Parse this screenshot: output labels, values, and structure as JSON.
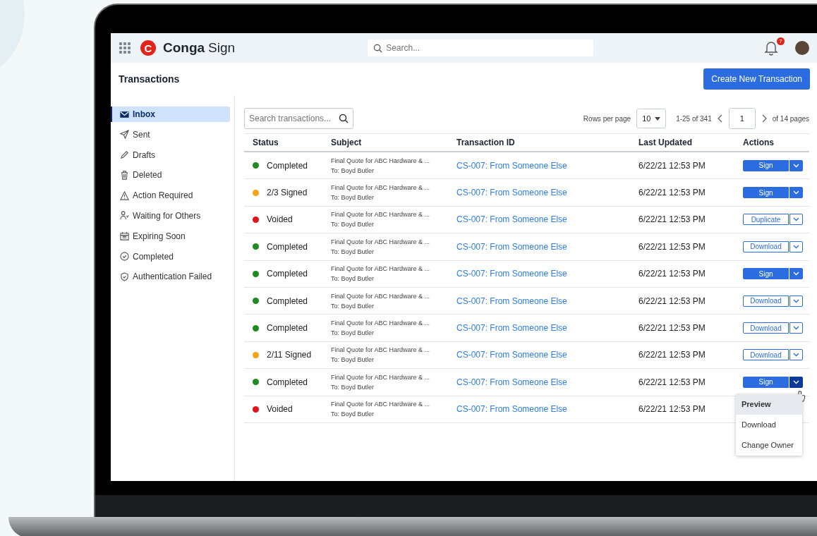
{
  "header": {
    "brand_mark": "C",
    "brand": "Conga",
    "brand_suffix": "Sign",
    "search": {
      "placeholder": "Search..."
    },
    "notifications": "7"
  },
  "page": {
    "title": "Transactions",
    "create_button": "Create New Transaction"
  },
  "sidebar": {
    "items": [
      {
        "label": "Inbox",
        "selected": true
      },
      {
        "label": "Sent",
        "selected": false
      },
      {
        "label": "Drafts",
        "selected": false
      },
      {
        "label": "Deleted",
        "selected": false
      },
      {
        "label": "Action Required",
        "selected": false
      },
      {
        "label": "Waiting for Others",
        "selected": false
      },
      {
        "label": "Expiring Soon",
        "selected": false
      },
      {
        "label": "Completed",
        "selected": false
      },
      {
        "label": "Authentication Failed",
        "selected": false
      }
    ]
  },
  "toolbar": {
    "search": {
      "placeholder": "Search transactions..."
    },
    "rows_label": "Rows per page",
    "rows_value": "10",
    "range": "1-25 of 341",
    "page": "1",
    "pages": "of 14 pages"
  },
  "table": {
    "columns": [
      "Status",
      "Subject",
      "Transaction ID",
      "Last Updated",
      "Actions"
    ],
    "rows": [
      {
        "status": "Completed",
        "color": "#1e8a1e",
        "subject": "Final Quote for ABC Hardware & ...",
        "to": "To: Boyd Butler",
        "id": "CS-007: From Someone Else",
        "updated": "6/22/21 12:53 PM",
        "action": "Sign",
        "kind": "primary",
        "menu_open": false
      },
      {
        "status": "2/3 Signed",
        "color": "#f5a416",
        "subject": "Final Quote for ABC Hardware & ...",
        "to": "To: Boyd Butler",
        "id": "CS-007: From Someone Else",
        "updated": "6/22/21 12:53 PM",
        "action": "Sign",
        "kind": "primary",
        "menu_open": false
      },
      {
        "status": "Voided",
        "color": "#e3111b",
        "subject": "Final Quote for ABC Hardware & ...",
        "to": "To: Boyd Butler",
        "id": "CS-007: From Someone Else",
        "updated": "6/22/21 12:53 PM",
        "action": "Duplicate",
        "kind": "outline",
        "menu_open": false
      },
      {
        "status": "Completed",
        "color": "#1e8a1e",
        "subject": "Final Quote for ABC Hardware & ...",
        "to": "To: Boyd Butler",
        "id": "CS-007: From Someone Else",
        "updated": "6/22/21 12:53 PM",
        "action": "Download",
        "kind": "outline",
        "menu_open": false
      },
      {
        "status": "Completed",
        "color": "#1e8a1e",
        "subject": "Final Quote for ABC Hardware & ...",
        "to": "To: Boyd Butler",
        "id": "CS-007: From Someone Else",
        "updated": "6/22/21 12:53 PM",
        "action": "Sign",
        "kind": "primary",
        "menu_open": false
      },
      {
        "status": "Completed",
        "color": "#1e8a1e",
        "subject": "Final Quote for ABC Hardware & ...",
        "to": "To: Boyd Butler",
        "id": "CS-007: From Someone Else",
        "updated": "6/22/21 12:53 PM",
        "action": "Download",
        "kind": "outline",
        "menu_open": false
      },
      {
        "status": "Completed",
        "color": "#1e8a1e",
        "subject": "Final Quote for ABC Hardware & ...",
        "to": "To: Boyd Butler",
        "id": "CS-007: From Someone Else",
        "updated": "6/22/21 12:53 PM",
        "action": "Download",
        "kind": "outline",
        "menu_open": false
      },
      {
        "status": "2/11 Signed",
        "color": "#f5a416",
        "subject": "Final Quote for ABC Hardware & ...",
        "to": "To: Boyd Butler",
        "id": "CS-007: From Someone Else",
        "updated": "6/22/21 12:53 PM",
        "action": "Download",
        "kind": "outline",
        "menu_open": false
      },
      {
        "status": "Completed",
        "color": "#1e8a1e",
        "subject": "Final Quote for ABC Hardware & ...",
        "to": "To: Boyd Butler",
        "id": "CS-007: From Someone Else",
        "updated": "6/22/21 12:53 PM",
        "action": "Sign",
        "kind": "primary",
        "menu_open": true
      },
      {
        "status": "Voided",
        "color": "#e3111b",
        "subject": "Final Quote for ABC Hardware & ...",
        "to": "To: Boyd Butler",
        "id": "CS-007: From Someone Else",
        "updated": "6/22/21 12:53 PM"
      }
    ]
  },
  "action_menu": {
    "items": [
      {
        "label": "Preview",
        "selected": true
      },
      {
        "label": "Download",
        "selected": false
      },
      {
        "label": "Change Owner",
        "selected": false
      }
    ]
  }
}
